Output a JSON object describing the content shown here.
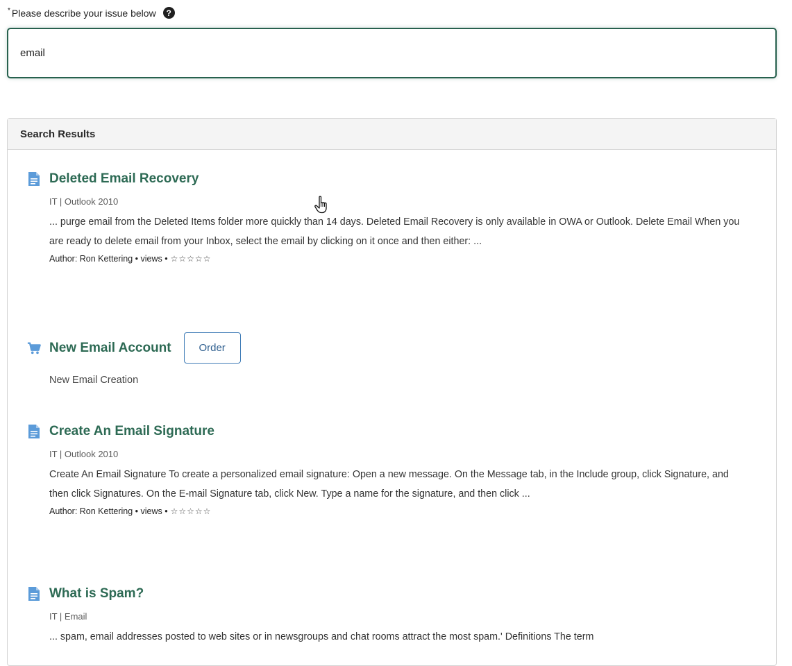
{
  "form": {
    "required_marker": "*",
    "label": "Please describe your issue below",
    "help_icon": "?",
    "input_value": "email"
  },
  "panel": {
    "title": "Search Results"
  },
  "results": [
    {
      "type": "knowledge-article",
      "icon": "document-icon",
      "title": "Deleted Email Recovery",
      "meta": "IT | Outlook 2010",
      "snippet": "... purge email from the Deleted Items folder more quickly than 14 days. Deleted Email Recovery is only available in OWA or Outlook. Delete Email When you are ready to delete email from your Inbox, select the email by clicking on it once and then either: ...",
      "author": "Author: Ron Kettering • views • ",
      "stars": "☆☆☆☆☆"
    },
    {
      "type": "catalog-item",
      "icon": "cart-icon",
      "title": "New Email Account",
      "button": "Order",
      "description": "New Email Creation"
    },
    {
      "type": "knowledge-article",
      "icon": "document-icon",
      "title": "Create An Email Signature",
      "meta": "IT | Outlook 2010",
      "snippet": "Create An Email Signature To create a personalized email signature: Open a new message. On the Message tab, in the Include group, click Signature, and then click Signatures. On the E-mail Signature tab, click New. Type a name for the signature, and then click ...",
      "author": "Author: Ron Kettering • views • ",
      "stars": "☆☆☆☆☆"
    },
    {
      "type": "knowledge-article",
      "icon": "document-icon",
      "title": "What is Spam?",
      "meta": "IT | Email",
      "snippet": "... spam, email addresses posted to web sites or in newsgroups and chat rooms attract the most spam.' Definitions The term"
    }
  ],
  "colors": {
    "title_green": "#2d6a54",
    "input_border": "#27614e",
    "icon_blue": "#5b9bd9",
    "button_blue": "#3e7bb6"
  }
}
